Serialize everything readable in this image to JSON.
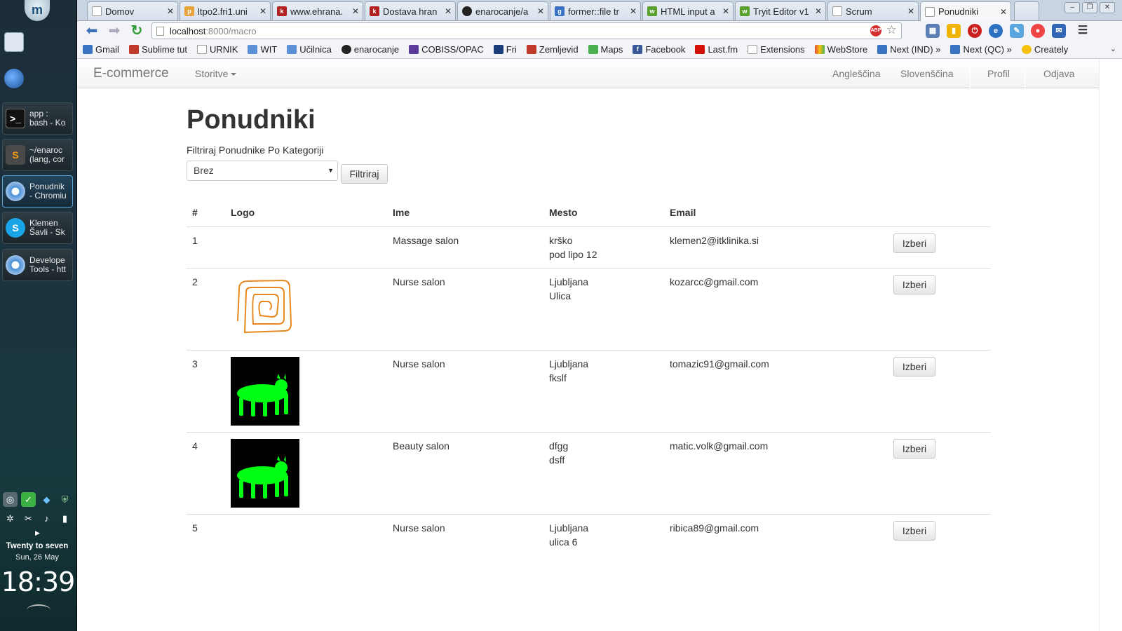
{
  "desktop": {
    "tasks": [
      {
        "line1": "app :",
        "line2": "bash - Ko"
      },
      {
        "line1": "~/enaroc",
        "line2": "(lang, cor"
      },
      {
        "line1": "Ponudnik",
        "line2": "- Chromiu"
      },
      {
        "line1": "Klemen",
        "line2": "Šavli - Sk"
      },
      {
        "line1": "Develope",
        "line2": "Tools - htt"
      }
    ],
    "clock": {
      "title": "Twenty to seven",
      "date": "Sun, 26 May",
      "time": "18:39"
    }
  },
  "browser": {
    "tabs": [
      {
        "title": "Domov",
        "color": "#ffffff"
      },
      {
        "title": "ltpo2.fri1.uni",
        "color": "#e8a33d"
      },
      {
        "title": "www.ehrana.",
        "color": "#b22222"
      },
      {
        "title": "Dostava hran",
        "color": "#b22222"
      },
      {
        "title": "enarocanje/a",
        "color": "#222222"
      },
      {
        "title": "former::file tr",
        "color": "#3b73c4"
      },
      {
        "title": "HTML input a",
        "color": "#5aa02c"
      },
      {
        "title": "Tryit Editor v1",
        "color": "#5aa02c"
      },
      {
        "title": "Scrum",
        "color": "#ffffff"
      },
      {
        "title": "Ponudniki",
        "color": "#ffffff"
      }
    ],
    "url_host": "localhost",
    "url_path": ":8000/macro",
    "bookmarks": [
      {
        "label": "Gmail",
        "color": "#3b73c4"
      },
      {
        "label": "Sublime tut",
        "color": "#c0392b"
      },
      {
        "label": "URNIK",
        "color": "#ffffff"
      },
      {
        "label": "WIT",
        "color": "#5b8fd6"
      },
      {
        "label": "Učilnica",
        "color": "#5b8fd6"
      },
      {
        "label": "enarocanje",
        "color": "#222222"
      },
      {
        "label": "COBISS/OPAC",
        "color": "#5b3c9c"
      },
      {
        "label": "Fri",
        "color": "#1b3d7a"
      },
      {
        "label": "Zemljevid",
        "color": "#c0392b"
      },
      {
        "label": "Maps",
        "color": "#4caf50"
      },
      {
        "label": "Facebook",
        "color": "#3b5998"
      },
      {
        "label": "Last.fm",
        "color": "#d51007"
      },
      {
        "label": "Extensions",
        "color": "#ffffff"
      },
      {
        "label": "WebStore",
        "color": "#e84a3c"
      },
      {
        "label": "Next (IND) »",
        "color": "#3b73c4"
      },
      {
        "label": "Next (QC) »",
        "color": "#3b73c4"
      },
      {
        "label": "Creately",
        "color": "#f4c20d"
      }
    ]
  },
  "navbar": {
    "brand": "E-commerce",
    "services": "Storitve",
    "english": "Angleščina",
    "slovenian": "Slovenščina",
    "profile": "Profil",
    "logout": "Odjava"
  },
  "main": {
    "title": "Ponudniki",
    "filter_label": "Filtriraj Ponudnike Po Kategoriji",
    "filter_selected": "Brez",
    "filter_button": "Filtriraj",
    "columns": [
      "#",
      "Logo",
      "Ime",
      "Mesto",
      "Email"
    ],
    "select_label": "Izberi",
    "rows": [
      {
        "num": "1",
        "logo": "none",
        "name": "Massage salon",
        "city": "krško",
        "street": "pod lipo 12",
        "email": "klemen2@itklinika.si"
      },
      {
        "num": "2",
        "logo": "spiral",
        "name": "Nurse salon",
        "city": "Ljubljana",
        "street": "Ulica",
        "email": "kozarcc@gmail.com"
      },
      {
        "num": "3",
        "logo": "green-animal",
        "name": "Nurse salon",
        "city": "Ljubljana",
        "street": "fkslf",
        "email": "tomazic91@gmail.com"
      },
      {
        "num": "4",
        "logo": "green-animal",
        "name": "Beauty salon",
        "city": "dfgg",
        "street": "dsff",
        "email": "matic.volk@gmail.com"
      },
      {
        "num": "5",
        "logo": "none",
        "name": "Nurse salon",
        "city": "Ljubljana",
        "street": "ulica 6",
        "email": "ribica89@gmail.com"
      }
    ]
  }
}
